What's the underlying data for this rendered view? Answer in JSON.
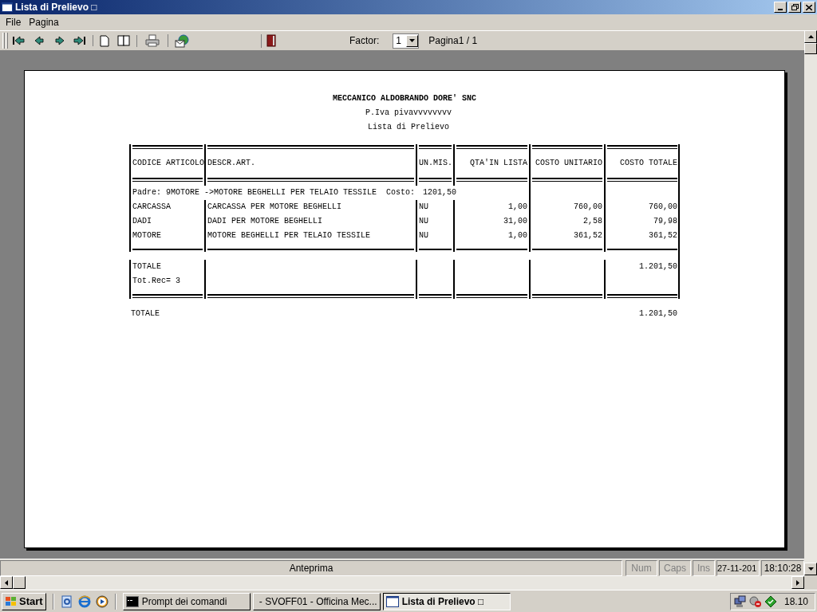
{
  "window": {
    "title": "Lista di Prelievo □"
  },
  "menu": [
    "File",
    "Pagina"
  ],
  "toolbar": {
    "factor_label": "Factor:",
    "factor_value": "1",
    "page": "Pagina1 / 1"
  },
  "report": {
    "company": "MECCANICO ALDOBRANDO DORE' SNC",
    "vat": "P.Iva pivavvvvvvvv",
    "title": "Lista di Prelievo",
    "columns": [
      "CODICE ARTICOLO",
      "DESCR.ART.",
      "UN.MIS.",
      "QTA'IN LISTA",
      "COSTO UNITARIO",
      "COSTO TOTALE"
    ],
    "parent_line": {
      "text": "Padre: 9MOTORE ->MOTORE BEGHELLI PER TELAIO TESSILE  Costo:",
      "cost": "1201,50"
    },
    "rows": [
      {
        "code": "CARCASSA",
        "description": "CARCASSA PER MOTORE BEGHELLI",
        "unit": "NU",
        "quantity": "1,00",
        "unit_cost": "760,00",
        "total_cost": "760,00"
      },
      {
        "code": "DADI",
        "description": "DADI PER MOTORE BEGHELLI",
        "unit": "NU",
        "quantity": "31,00",
        "unit_cost": "2,58",
        "total_cost": "79,98"
      },
      {
        "code": "MOTORE",
        "description": "MOTORE BEGHELLI PER TELAIO TESSILE",
        "unit": "NU",
        "quantity": "1,00",
        "unit_cost": "361,52",
        "total_cost": "361,52"
      }
    ],
    "total": {
      "label": "TOTALE",
      "record_count": "Tot.Rec= 3",
      "value": "1.201,50"
    },
    "grand_total": {
      "label": "TOTALE",
      "value": "1.201,50"
    }
  },
  "status_bar": {
    "message": "Anteprima",
    "indicators": [
      {
        "label": "Num",
        "on": false
      },
      {
        "label": "Caps",
        "on": false
      },
      {
        "label": "Ins",
        "on": false
      }
    ],
    "date": "27-11-201",
    "time": "18:10:28"
  },
  "taskbar": {
    "start": "Start",
    "tasks": [
      {
        "label": "Prompt dei comandi",
        "kind": "console",
        "selected": false
      },
      {
        "label": "- SVOFF01 - Officina Mec...",
        "kind": "window",
        "selected": false
      },
      {
        "label": "Lista di Prelievo □",
        "kind": "window",
        "selected": true
      }
    ],
    "clock": "18.10"
  }
}
